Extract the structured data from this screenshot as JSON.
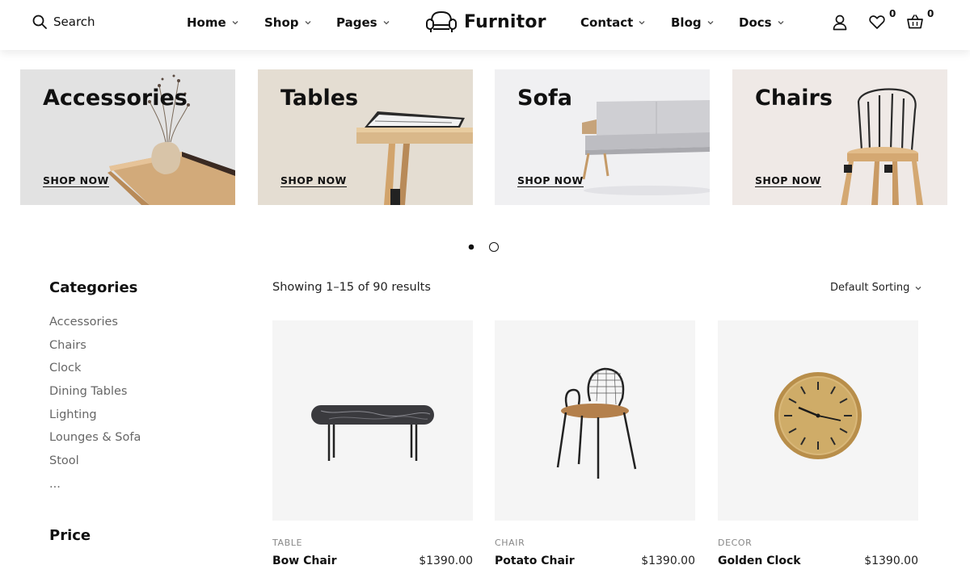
{
  "header": {
    "search_label": "Search",
    "nav_left": [
      {
        "label": "Home"
      },
      {
        "label": "Shop"
      },
      {
        "label": "Pages"
      }
    ],
    "brand": "Furnitor",
    "nav_right": [
      {
        "label": "Contact"
      },
      {
        "label": "Blog"
      },
      {
        "label": "Docs"
      }
    ],
    "wishlist_count": "0",
    "cart_count": "0"
  },
  "banners": [
    {
      "title": "Accessories",
      "cta": "SHOP NOW",
      "bg": "#e2e2e2"
    },
    {
      "title": "Tables",
      "cta": "SHOP NOW",
      "bg": "#e4ddd2"
    },
    {
      "title": "Sofa",
      "cta": "SHOP NOW",
      "bg": "#f0f0f2"
    },
    {
      "title": "Chairs",
      "cta": "SHOP NOW",
      "bg": "#efe9e6"
    }
  ],
  "carousel": {
    "active_index": 0,
    "total": 2
  },
  "sidebar": {
    "categories_title": "Categories",
    "categories": [
      "Accessories",
      "Chairs",
      "Clock",
      "Dining Tables",
      "Lighting",
      "Lounges & Sofa",
      "Stool",
      "..."
    ],
    "price_title": "Price"
  },
  "shop": {
    "results_text": "Showing 1–15 of 90 results",
    "sort_label": "Default Sorting"
  },
  "products": [
    {
      "category": "TABLE",
      "name": "Bow Chair",
      "price": "$1390.00"
    },
    {
      "category": "CHAIR",
      "name": "Potato Chair",
      "price": "$1390.00"
    },
    {
      "category": "DECOR",
      "name": "Golden Clock",
      "price": "$1390.00"
    }
  ]
}
